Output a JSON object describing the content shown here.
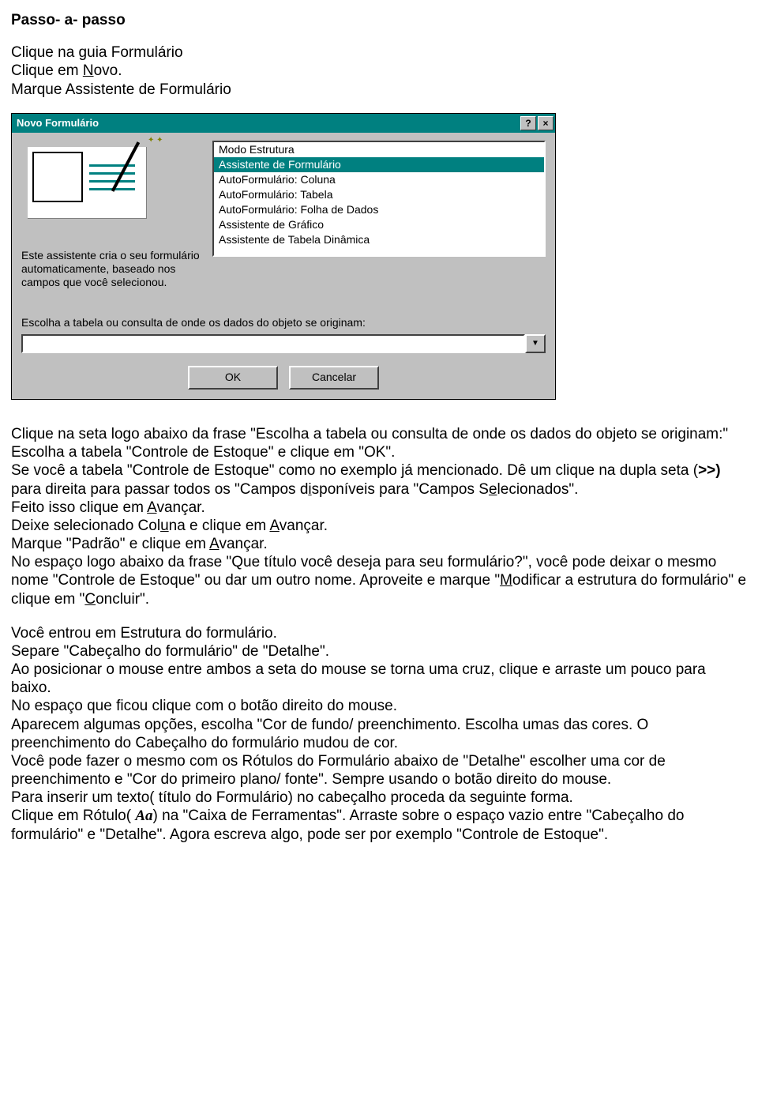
{
  "heading": "Passo- a- passo",
  "intro": {
    "line1_pre": "Clique na guia Formulário",
    "line2_pre": "Clique em ",
    "line2_u": "N",
    "line2_post": "ovo.",
    "line3": "Marque Assistente de Formulário"
  },
  "dialog": {
    "title": "Novo Formulário",
    "help_btn": "?",
    "close_btn": "×",
    "options": [
      "Modo Estrutura",
      "Assistente de Formulário",
      "AutoFormulário:  Coluna",
      "AutoFormulário:  Tabela",
      "AutoFormulário:  Folha de Dados",
      "Assistente de Gráfico",
      "Assistente de Tabela Dinâmica"
    ],
    "selected_index": 1,
    "description": "Este assistente cria o seu formulário automaticamente, baseado nos campos que você selecionou.",
    "prompt": "Escolha a tabela ou consulta de onde os dados do objeto se originam:",
    "ok": "OK",
    "cancel": "Cancelar",
    "combo_value": "",
    "combo_arrow": "▼"
  },
  "para1": {
    "l1": "Clique na seta logo abaixo da frase \"Escolha a tabela ou consulta de onde os dados do objeto se originam:\"",
    "l2": "Escolha a tabela \"Controle de Estoque\" e clique em \"OK\".",
    "l3": "Se você a tabela \"Controle de Estoque\" como no exemplo já mencionado. Dê um clique na dupla seta (",
    "l3_b": ">>)",
    "l3_c": " para direita para passar todos os \"Campos d",
    "l3_u": "i",
    "l3_d": "sponíveis para \"Campos S",
    "l3_u2": "e",
    "l3_e": "lecionados\".",
    "l4_a": "Feito isso clique em ",
    "l4_u": "A",
    "l4_b": "vançar.",
    "l5_a": "Deixe selecionado Col",
    "l5_u": "u",
    "l5_b": "na e clique em ",
    "l5_u2": "A",
    "l5_c": "vançar.",
    "l6_a": "Marque \"Padrão\" e clique em ",
    "l6_u": "A",
    "l6_b": "vançar.",
    "l7": "No espaço logo abaixo da frase \"Que título você deseja para seu formulário?\", você pode deixar o mesmo nome \"Controle de Estoque\" ou dar um outro nome. Aproveite e marque \"",
    "l7_u": "M",
    "l7_b": "odificar a estrutura do formulário\" e clique em \"",
    "l7_u2": "C",
    "l7_c": "oncluir\"."
  },
  "para2": {
    "l1": "Você entrou em Estrutura do formulário.",
    "l2": "Separe \"Cabeçalho do formulário\" de \"Detalhe\".",
    "l3": "Ao posicionar o mouse entre ambos a seta do mouse se torna uma cruz, clique e arraste um pouco para baixo.",
    "l4": "No espaço que ficou clique com o botão direito do mouse.",
    "l5": "Aparecem algumas opções, escolha \"Cor de fundo/ preenchimento. Escolha umas das cores. O preenchimento do Cabeçalho do formulário mudou de cor.",
    "l6": "Você pode fazer o mesmo com os Rótulos do Formulário abaixo de \"Detalhe\" escolher uma cor de preenchimento e \"Cor do primeiro plano/ fonte\". Sempre usando o botão direito do mouse.",
    "l7": "Para inserir um texto( título do Formulário)  no cabeçalho proceda da seguinte forma.",
    "l8_a": "Clique em Rótulo( ",
    "l8_aa": "Aa",
    "l8_b": ") na  \"Caixa de Ferramentas\". Arraste sobre o espaço vazio entre \"Cabeçalho do formulário\" e \"Detalhe\". Agora escreva algo, pode ser por exemplo \"Controle de Estoque\"."
  }
}
